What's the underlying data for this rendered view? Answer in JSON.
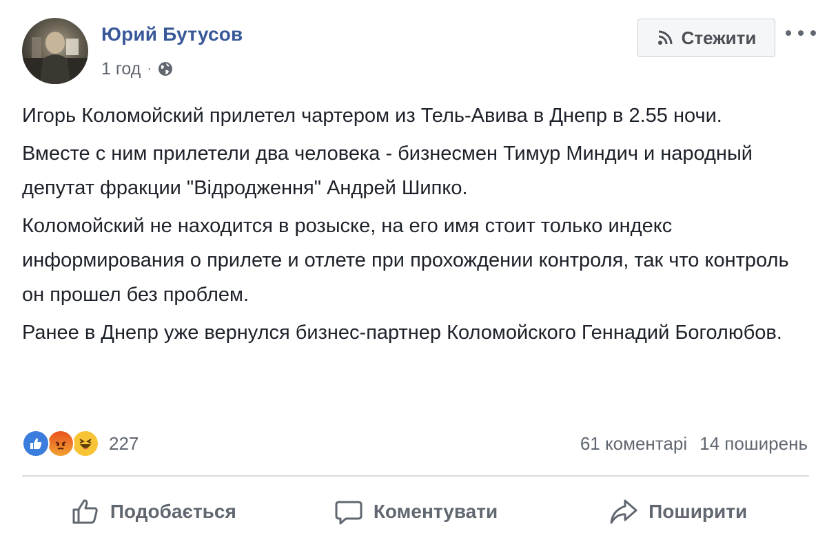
{
  "post": {
    "author": "Юрий Бутусов",
    "time": "1 год",
    "separator": "·",
    "visibility_icon": "globe-icon",
    "follow_label": "Стежити",
    "follow_icon": "rss-icon",
    "more_icon": "more-options-icon",
    "paragraphs": [
      "Игорь Коломойский прилетел чартером из Тель-Авива в Днепр в 2.55 ночи.",
      "Вместе с ним прилетели два человека - бизнесмен Тимур Миндич и народный депутат фракции \"Відродження\" Андрей Шипко.",
      "Коломойский не находится в розыске, на его имя стоит только индекс информирования о прилете и отлете при прохождении контроля, так что контроль он прошел без проблем.",
      "Ранее в Днепр уже вернулся бизнес-партнер Коломойского Геннадий Боголюбов."
    ]
  },
  "engagement": {
    "reactions": [
      "like",
      "angry",
      "haha"
    ],
    "reaction_count": "227",
    "comments": "61 коментарі",
    "shares": "14 поширень"
  },
  "actions": {
    "like": "Подобається",
    "comment": "Коментувати",
    "share": "Поширити"
  },
  "colors": {
    "author": "#385898",
    "meta": "#616770",
    "text": "#1d2129",
    "divider": "#dadde1",
    "like_blue": "#3b7ddd"
  }
}
